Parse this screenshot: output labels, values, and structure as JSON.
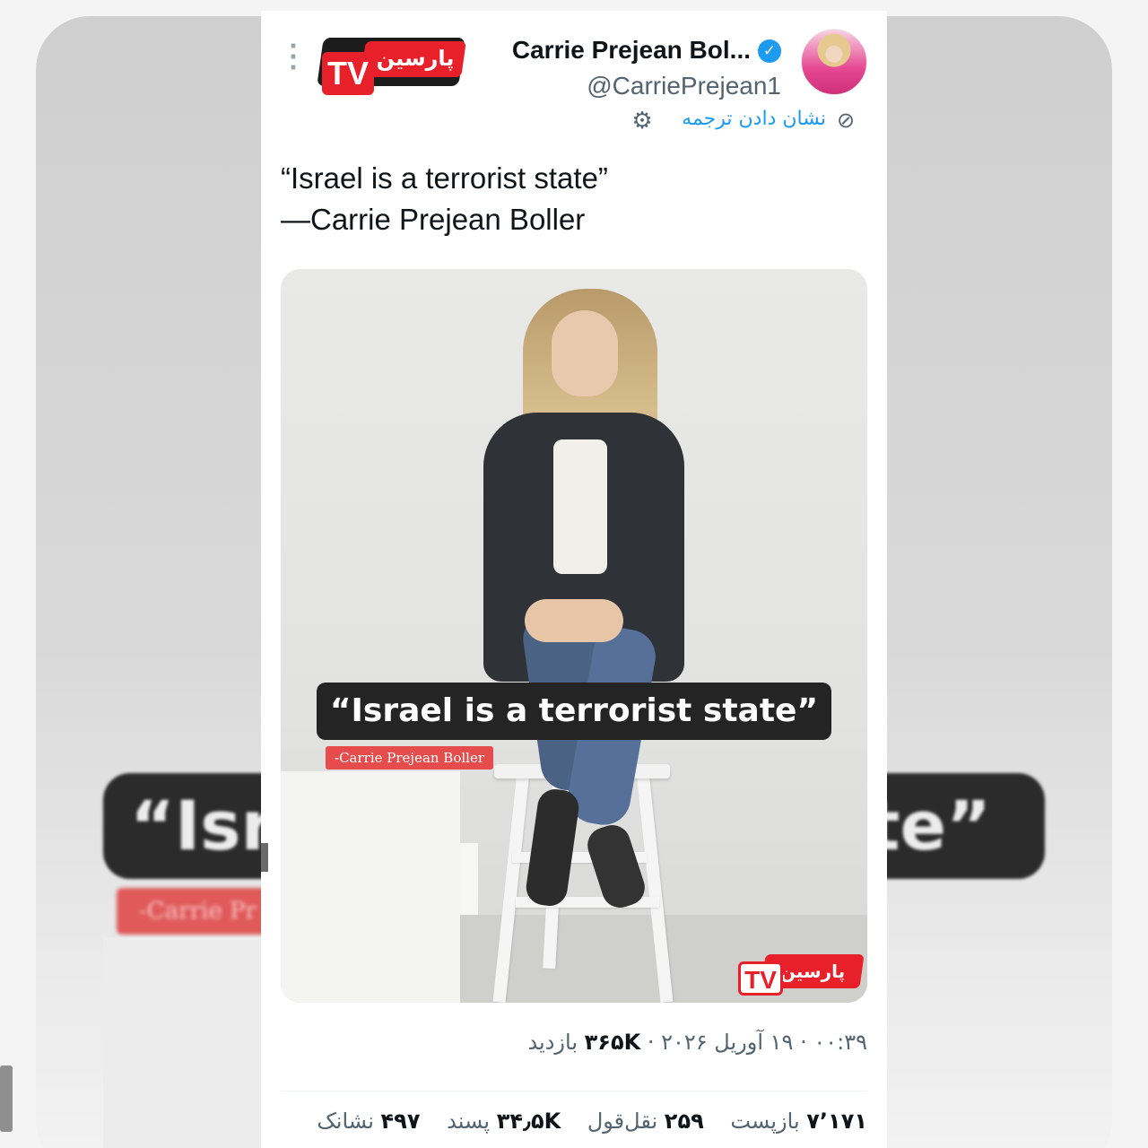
{
  "backdrop": {
    "quote_left": "“Isr",
    "quote_right": "te”",
    "attr": "-Carrie Pr"
  },
  "tweet": {
    "author_name": "Carrie Prejean Bol...",
    "handle": "@CarriePrejean1",
    "translate_label": "نشان دادن ترجمه",
    "line1": "“Israel is a terrorist state”",
    "line2": "—Carrie Prejean Boller",
    "media": {
      "quote": "“Israel is a terrorist state”",
      "attribution": "-Carrie Prejean Boller",
      "watermark_fa": "پارسین",
      "watermark_tv": "TV"
    },
    "meta": {
      "time": "۰۰:۳۹",
      "date": "۱۹ آوریل ۲۰۲۶",
      "views_count": "۳۶۵K",
      "views_label": "بازدید",
      "sep": "·"
    },
    "stats": {
      "reposts_count": "۷٬۱۷۱",
      "reposts_label": "بازپست",
      "quotes_count": "۲۵۹",
      "quotes_label": "نقل‌قول",
      "likes_count": "۳۴٫۵K",
      "likes_label": "پسند",
      "bookmarks_count": "۴۹۷",
      "bookmarks_label": "نشانک"
    }
  },
  "logo": {
    "fa": "پارسین",
    "tv": "TV"
  },
  "icons": {
    "more": "more-vertical-icon",
    "verified": "verified-badge-icon",
    "translate": "translate-icon",
    "settings": "gear-icon"
  },
  "colors": {
    "accent": "#1d9bf0",
    "brand_red": "#e8202a",
    "text": "#0f1419",
    "muted": "#536471"
  }
}
